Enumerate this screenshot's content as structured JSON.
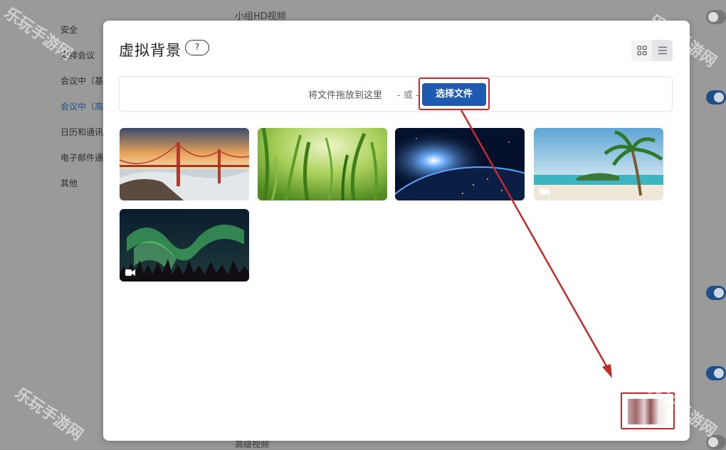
{
  "background": {
    "top_title": "小组HD视频",
    "bottom_title": "高级视频",
    "sidebar_items": [
      "安全",
      "安排会议",
      "会议中（基本）",
      "会议中（高级）",
      "日历和通讯录",
      "电子邮件通知",
      "其他"
    ]
  },
  "modal": {
    "title": "虚拟背景",
    "help_icon": "?",
    "view_icons": [
      "grid-icon",
      "list-icon"
    ],
    "drop_text": "将文件拖放到这里",
    "drop_or": "- 或 -",
    "select_button": "选择文件",
    "thumbnails": [
      {
        "name": "golden-gate-bridge",
        "video": false
      },
      {
        "name": "grass",
        "video": false
      },
      {
        "name": "earth-from-space",
        "video": false
      },
      {
        "name": "beach-palm",
        "video": true
      },
      {
        "name": "aurora",
        "video": true
      }
    ]
  },
  "annotation": {
    "color": "#c62a2a"
  },
  "watermark": "乐玩手游网",
  "colors": {
    "accent": "#1e5bb0",
    "highlight": "#c62a2a"
  }
}
